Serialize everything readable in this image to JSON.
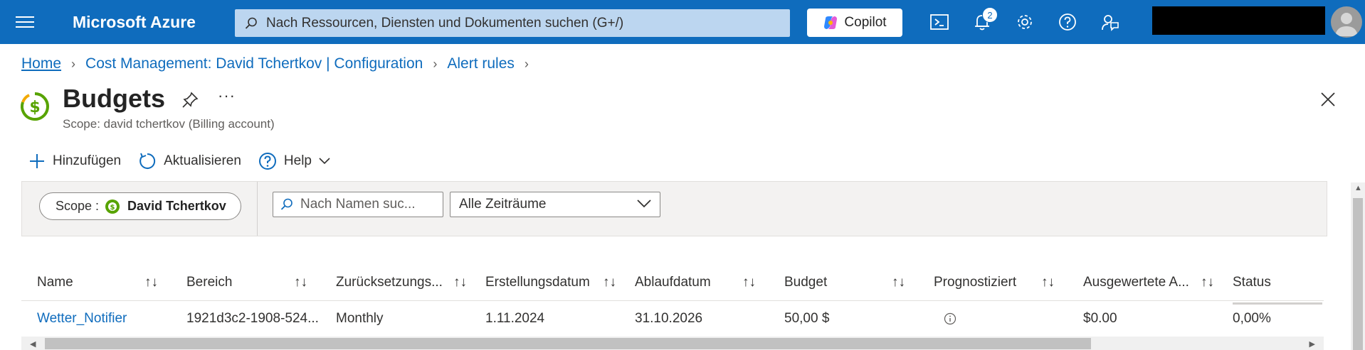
{
  "topbar": {
    "brand": "Microsoft Azure",
    "search_placeholder": "Nach Ressourcen, Diensten und Dokumenten suchen (G+/)",
    "copilot_label": "Copilot",
    "notification_count": "2",
    "icons": [
      "menu-icon",
      "search-icon",
      "cloud-shell-icon",
      "notifications-icon",
      "settings-icon",
      "help-icon",
      "feedback-icon"
    ]
  },
  "breadcrumb": {
    "items": [
      "Home",
      "Cost Management: David Tchertkov | Configuration",
      "Alert rules"
    ]
  },
  "header": {
    "title": "Budgets",
    "subtitle": "Scope: david tchertkov (Billing account)",
    "more_label": "···"
  },
  "toolbar": {
    "add_label": "Hinzufügen",
    "refresh_label": "Aktualisieren",
    "help_label": "Help"
  },
  "filters": {
    "scope_label": "Scope :",
    "scope_value": "David Tchertkov",
    "name_placeholder": "Nach Namen suc...",
    "period_value": "Alle Zeiträume"
  },
  "table": {
    "columns": [
      "Name",
      "Bereich",
      "Zurücksetzungs...",
      "Erstellungsdatum",
      "Ablaufdatum",
      "Budget",
      "Prognostiziert",
      "Ausgewertete A...",
      "Status"
    ],
    "sort_glyph": "↑↓",
    "rows": [
      {
        "name": "Wetter_Notifier",
        "bereich": "1921d3c2-1908-524...",
        "reset": "Monthly",
        "created": "1.11.2024",
        "expires": "31.10.2026",
        "budget": "50,00 $",
        "forecast_icon": "info-icon",
        "evaluated": "$0.00",
        "status": "0,00%",
        "status_fraction": 0.0
      }
    ]
  },
  "colors": {
    "brand_blue": "#0f6cbd",
    "budget_green": "#57a300",
    "budget_orange": "#f2a900"
  }
}
